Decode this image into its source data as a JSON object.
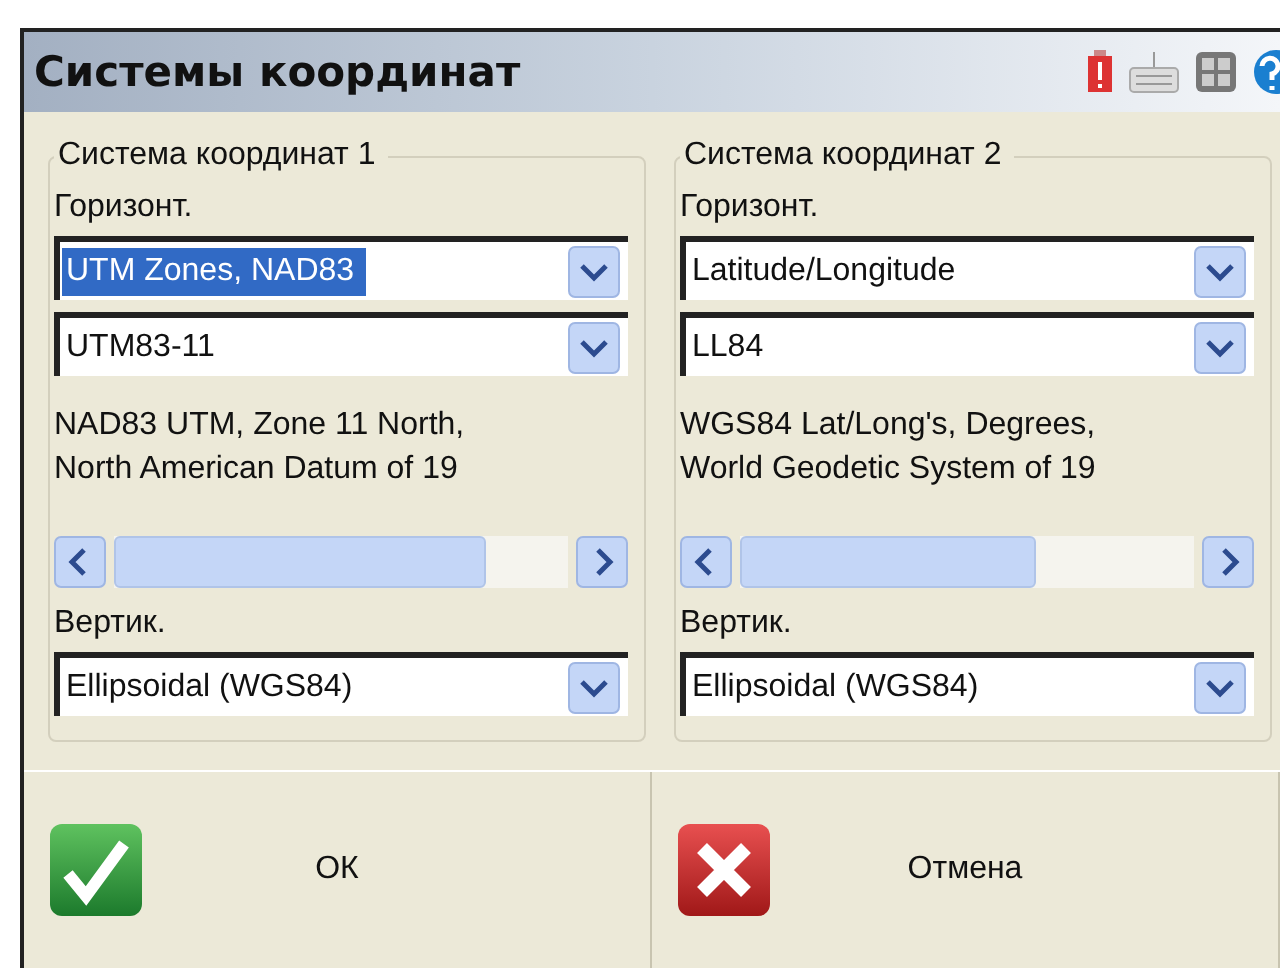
{
  "window": {
    "title": "Системы координат"
  },
  "groups": [
    {
      "title": "Система координат 1",
      "horizontal_label": "Горизонт.",
      "combos": [
        {
          "value": "UTM Zones, NAD83",
          "focused": true
        },
        {
          "value": "UTM83-11",
          "focused": false
        }
      ],
      "description": [
        "NAD83 UTM, Zone 11 North,",
        "North American Datum of 19"
      ],
      "vertical_label": "Вертик.",
      "vertical_combo": {
        "value": "Ellipsoidal (WGS84)",
        "focused": false
      }
    },
    {
      "title": "Система координат 2",
      "horizontal_label": "Горизонт.",
      "combos": [
        {
          "value": "Latitude/Longitude",
          "focused": false
        },
        {
          "value": "LL84",
          "focused": false
        }
      ],
      "description": [
        "WGS84 Lat/Long's, Degrees,",
        "World Geodetic System of 19"
      ],
      "vertical_label": "Вертик.",
      "vertical_combo": {
        "value": "Ellipsoidal (WGS84)",
        "focused": false
      }
    }
  ],
  "buttons": [
    {
      "kind": "ok",
      "label": "ОК"
    },
    {
      "kind": "cancel",
      "label": "Отмена"
    }
  ]
}
